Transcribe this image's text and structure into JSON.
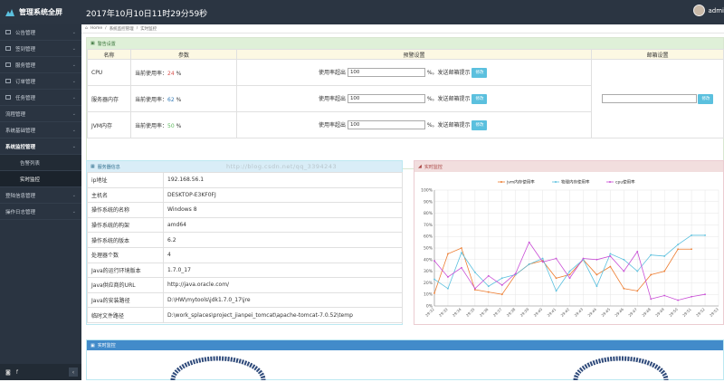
{
  "header": {
    "title": "管理系统全屏",
    "clock": "2017年10月10日11时29分59秒",
    "user": "admi"
  },
  "sidebar": {
    "items": [
      {
        "label": "公告管理",
        "icon": "home-icon",
        "type": "top"
      },
      {
        "label": "签到管理",
        "icon": "calendar-icon",
        "type": "top"
      },
      {
        "label": "服务管理",
        "icon": "list-icon",
        "type": "top"
      },
      {
        "label": "订单管理",
        "icon": "order-icon",
        "type": "top"
      },
      {
        "label": "任务管理",
        "icon": "task-icon",
        "type": "top"
      },
      {
        "label": "流程管理",
        "icon": "",
        "type": "top"
      },
      {
        "label": "系统基础管理",
        "icon": "",
        "type": "top"
      },
      {
        "label": "系统监控管理",
        "icon": "",
        "type": "open"
      },
      {
        "label": "告警列表",
        "icon": "",
        "type": "sub"
      },
      {
        "label": "实时监控",
        "icon": "",
        "type": "active"
      },
      {
        "label": "登陆信息管理",
        "icon": "",
        "type": "top"
      },
      {
        "label": "操作日志管理",
        "icon": "",
        "type": "top"
      }
    ]
  },
  "breadcrumb": [
    "Home",
    "系统监控管理",
    "实时监控"
  ],
  "warning": {
    "title": "警告设置",
    "columns": [
      "名称",
      "参数",
      "预警设置",
      "邮箱设置"
    ],
    "rows": [
      {
        "name": "CPU",
        "prefix": "当前使用率：",
        "value": "24",
        "unit": "%",
        "threshold_label": "使用率超出",
        "threshold": "100",
        "send": "%。发送邮箱提示",
        "btn": "修改",
        "color": "red"
      },
      {
        "name": "服务器内存",
        "prefix": "当前使用率：",
        "value": "62",
        "unit": "%",
        "threshold_label": "使用率超出",
        "threshold": "100",
        "send": "%。发送邮箱提示",
        "btn": "修改",
        "color": "blue"
      },
      {
        "name": "JVM内存",
        "prefix": "当前使用率：",
        "value": "50",
        "unit": "%",
        "threshold_label": "使用率超出",
        "threshold": "100",
        "send": "%。发送邮箱提示",
        "btn": "修改",
        "color": "green"
      }
    ],
    "email": {
      "value": "",
      "btn": "修改"
    }
  },
  "server": {
    "title": "服务器信息",
    "rows": [
      [
        "ip地址",
        "192.168.56.1"
      ],
      [
        "主机名",
        "DESKTOP-E3KF0FJ"
      ],
      [
        "操作系统的名称",
        "Windows 8"
      ],
      [
        "操作系统的构架",
        "amd64"
      ],
      [
        "操作系统的版本",
        "6.2"
      ],
      [
        "处理器个数",
        "4"
      ],
      [
        "Java的运行环境版本",
        "1.7.0_17"
      ],
      [
        "Java供应商的URL",
        "http://java.oracle.com/"
      ],
      [
        "Java的安装路径",
        "D:\\HW\\mytools\\jdk1.7.0_17\\jre"
      ],
      [
        "临时文件路径",
        "D:\\work_splaces\\project_jianpei_tomcat\\apache-tomcat-7.0.52\\temp"
      ]
    ]
  },
  "monitor": {
    "title": "实时监控"
  },
  "realtime": {
    "title": "实时监控"
  },
  "watermark": "http://blog.csdn.net/qq_3394243",
  "chart_data": {
    "type": "line",
    "ylim": [
      0,
      100
    ],
    "yticks": [
      "0%",
      "10%",
      "20%",
      "30%",
      "40%",
      "50%",
      "60%",
      "70%",
      "80%",
      "90%",
      "100%"
    ],
    "categories": [
      "29:32",
      "29:33",
      "29:34",
      "29:35",
      "29:36",
      "29:37",
      "29:38",
      "29:39",
      "29:40",
      "29:41",
      "29:42",
      "29:43",
      "29:44",
      "29:45",
      "29:46",
      "29:47",
      "29:48",
      "29:49",
      "29:50",
      "29:51",
      "29:52",
      "29:53"
    ],
    "series": [
      {
        "name": "jvm内存使用率",
        "color": "#ed7d31",
        "values": [
          11,
          45,
          50,
          14,
          12,
          10,
          27,
          36,
          39,
          24,
          27,
          40,
          27,
          34,
          15,
          13,
          27,
          30,
          49,
          49
        ]
      },
      {
        "name": "物理内存使用率",
        "color": "#5bc0de",
        "values": [
          23,
          15,
          46,
          29,
          17,
          24,
          27,
          36,
          41,
          13,
          30,
          40,
          17,
          45,
          40,
          30,
          44,
          43,
          53,
          61,
          61
        ]
      },
      {
        "name": "cpu使用率",
        "color": "#c94fd6",
        "values": [
          39,
          25,
          33,
          15,
          26,
          18,
          28,
          55,
          38,
          41,
          24,
          41,
          40,
          43,
          30,
          47,
          6,
          9,
          5,
          8,
          10
        ]
      }
    ]
  }
}
